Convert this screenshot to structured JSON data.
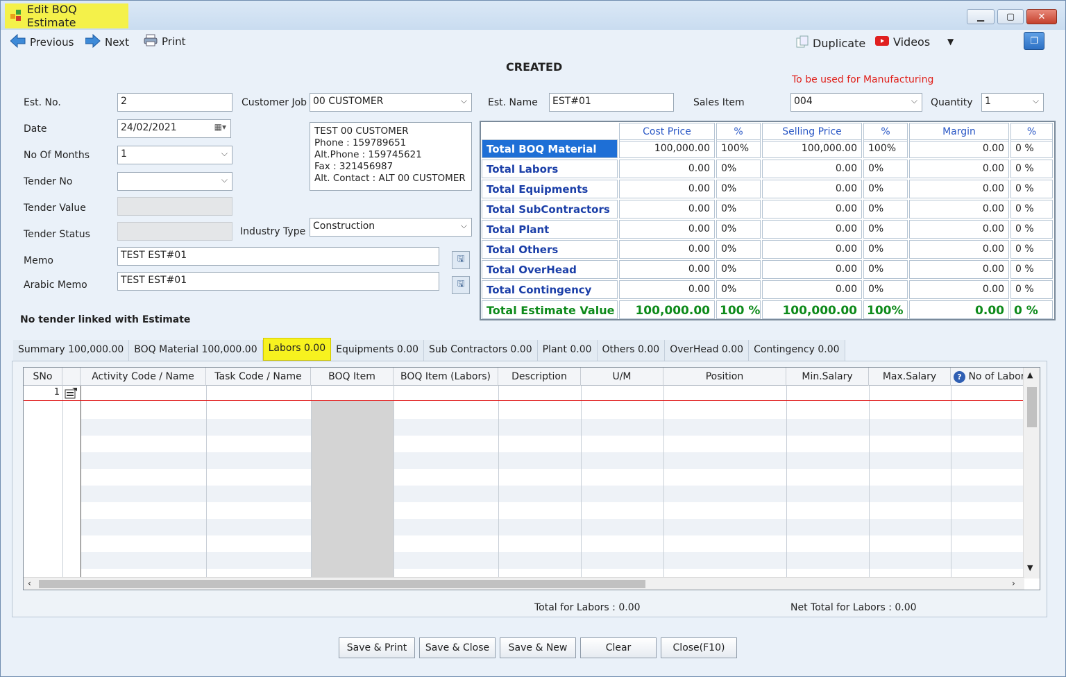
{
  "window": {
    "title": "Edit BOQ Estimate"
  },
  "toolbar": {
    "previous": "Previous",
    "next": "Next",
    "print": "Print",
    "duplicate": "Duplicate",
    "videos": "Videos"
  },
  "status": "CREATED",
  "manufacturing_note": "To be used for Manufacturing",
  "form": {
    "est_no_label": "Est. No.",
    "est_no": "2",
    "date_label": "Date",
    "date": "24/02/2021",
    "months_label": "No Of Months",
    "months": "1",
    "tender_no_label": "Tender No",
    "tender_no": "",
    "tender_value_label": "Tender Value",
    "tender_status_label": "Tender Status",
    "memo_label": "Memo",
    "memo": "TEST EST#01",
    "arabic_memo_label": "Arabic Memo",
    "arabic_memo": "TEST EST#01",
    "customer_job_label": "Customer Job",
    "customer_job": "00 CUSTOMER",
    "customer_info": [
      "TEST 00 CUSTOMER",
      "Phone : 159789651",
      "Alt.Phone : 159745621",
      "Fax : 321456987",
      "Alt. Contact : ALT 00 CUSTOMER"
    ],
    "industry_type_label": "Industry Type",
    "industry_type": "Construction",
    "est_name_label": "Est. Name",
    "est_name": "EST#01",
    "sales_item_label": "Sales Item",
    "sales_item": "004",
    "quantity_label": "Quantity",
    "quantity": "1",
    "tender_link_note": "No tender linked with Estimate"
  },
  "cost_table": {
    "headers": [
      "Cost Price",
      "%",
      "Selling Price",
      "%",
      "Margin",
      "%"
    ],
    "rows": [
      {
        "label": "Total BOQ Material",
        "cost": "100,000.00",
        "cost_pct": "100%",
        "sell": "100,000.00",
        "sell_pct": "100%",
        "margin": "0.00",
        "margin_pct": "0 %"
      },
      {
        "label": "Total Labors",
        "cost": "0.00",
        "cost_pct": "0%",
        "sell": "0.00",
        "sell_pct": "0%",
        "margin": "0.00",
        "margin_pct": "0 %"
      },
      {
        "label": "Total Equipments",
        "cost": "0.00",
        "cost_pct": "0%",
        "sell": "0.00",
        "sell_pct": "0%",
        "margin": "0.00",
        "margin_pct": "0 %"
      },
      {
        "label": "Total SubContractors",
        "cost": "0.00",
        "cost_pct": "0%",
        "sell": "0.00",
        "sell_pct": "0%",
        "margin": "0.00",
        "margin_pct": "0 %"
      },
      {
        "label": "Total Plant",
        "cost": "0.00",
        "cost_pct": "0%",
        "sell": "0.00",
        "sell_pct": "0%",
        "margin": "0.00",
        "margin_pct": "0 %"
      },
      {
        "label": "Total Others",
        "cost": "0.00",
        "cost_pct": "0%",
        "sell": "0.00",
        "sell_pct": "0%",
        "margin": "0.00",
        "margin_pct": "0 %"
      },
      {
        "label": "Total OverHead",
        "cost": "0.00",
        "cost_pct": "0%",
        "sell": "0.00",
        "sell_pct": "0%",
        "margin": "0.00",
        "margin_pct": "0 %"
      },
      {
        "label": "Total Contingency",
        "cost": "0.00",
        "cost_pct": "0%",
        "sell": "0.00",
        "sell_pct": "0%",
        "margin": "0.00",
        "margin_pct": "0 %"
      }
    ],
    "total": {
      "label": "Total Estimate Value",
      "cost": "100,000.00",
      "cost_pct": "100 %",
      "sell": "100,000.00",
      "sell_pct": "100%",
      "margin": "0.00",
      "margin_pct": "0 %"
    }
  },
  "tabs": [
    "Summary  100,000.00",
    "BOQ Material  100,000.00",
    "Labors 0.00",
    "Equipments 0.00",
    "Sub Contractors 0.00",
    "Plant  0.00",
    "Others  0.00",
    "OverHead 0.00",
    "Contingency 0.00"
  ],
  "grid": {
    "columns": [
      "SNo",
      "",
      "Activity Code / Name",
      "Task Code / Name",
      "BOQ Item",
      "BOQ Item (Labors)",
      "Description",
      "U/M",
      "Position",
      "Min.Salary",
      "Max.Salary",
      "No of Labors"
    ],
    "first_row_sno": "1"
  },
  "footer": {
    "total_labors": "Total for Labors : 0.00",
    "net_total_labors": "Net Total for Labors : 0.00"
  },
  "buttons": {
    "save_print": "Save & Print",
    "save_close": "Save & Close",
    "save_new": "Save & New",
    "clear": "Clear",
    "close": "Close(F10)"
  },
  "colors": {
    "highlight": "#f7f21f",
    "selected_row": "#1e6fd6",
    "label_blue": "#1b3fa8",
    "total_green": "#0d8a1a",
    "note_red": "#e0201a"
  }
}
